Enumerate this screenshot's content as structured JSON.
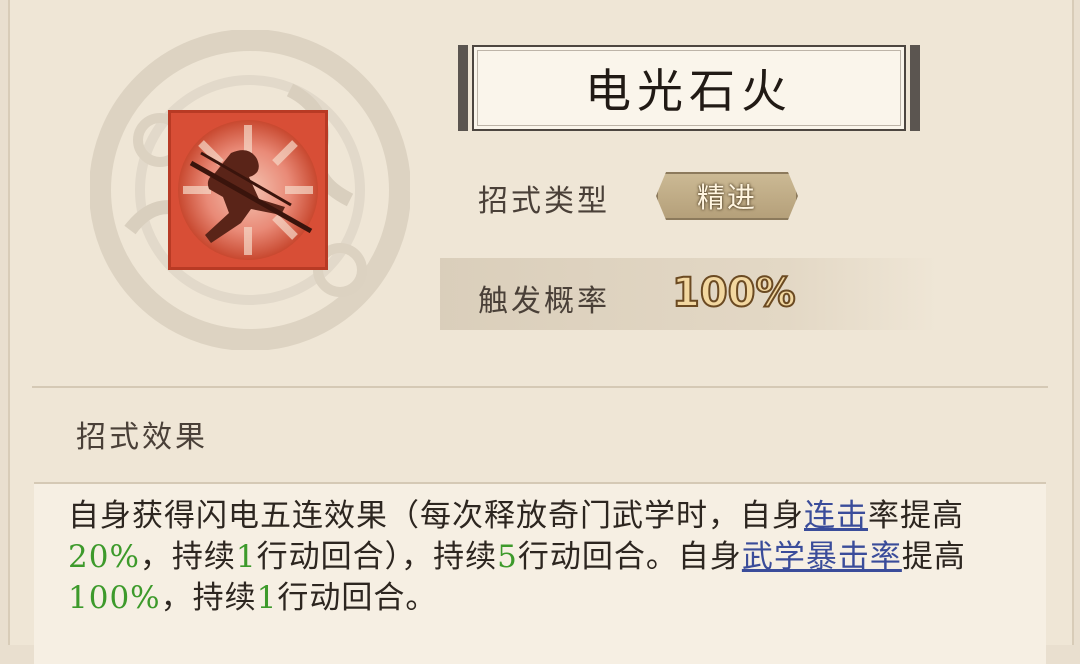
{
  "skill": {
    "name": "电光石火",
    "icon": "martial-artist-strike-icon"
  },
  "attributes": {
    "type_label": "招式类型",
    "type_value": "精进",
    "prob_label": "触发概率",
    "prob_value": "100%"
  },
  "effect": {
    "heading": "招式效果",
    "segments": [
      {
        "text": "自身获得闪电五连效果（每次释放奇门武学时，自身",
        "style": "normal"
      },
      {
        "text": "连击",
        "style": "link"
      },
      {
        "text": "率",
        "style": "normal"
      },
      {
        "text": "提高",
        "style": "normal"
      },
      {
        "text": "20%",
        "style": "green"
      },
      {
        "text": "，持续",
        "style": "normal"
      },
      {
        "text": "1",
        "style": "green"
      },
      {
        "text": "行动回合），持续",
        "style": "normal"
      },
      {
        "text": "5",
        "style": "green"
      },
      {
        "text": "行动回合。自身",
        "style": "normal"
      },
      {
        "text": "武学暴击率",
        "style": "link"
      },
      {
        "text": "提高",
        "style": "normal"
      },
      {
        "text": "100%",
        "style": "green"
      },
      {
        "text": "，持续",
        "style": "normal"
      },
      {
        "text": "1",
        "style": "green"
      },
      {
        "text": "行动回合。",
        "style": "normal"
      }
    ]
  },
  "colors": {
    "highlight_green": "#3d9a2b",
    "link_blue": "#3a4c9a",
    "icon_red": "#e5533b"
  }
}
